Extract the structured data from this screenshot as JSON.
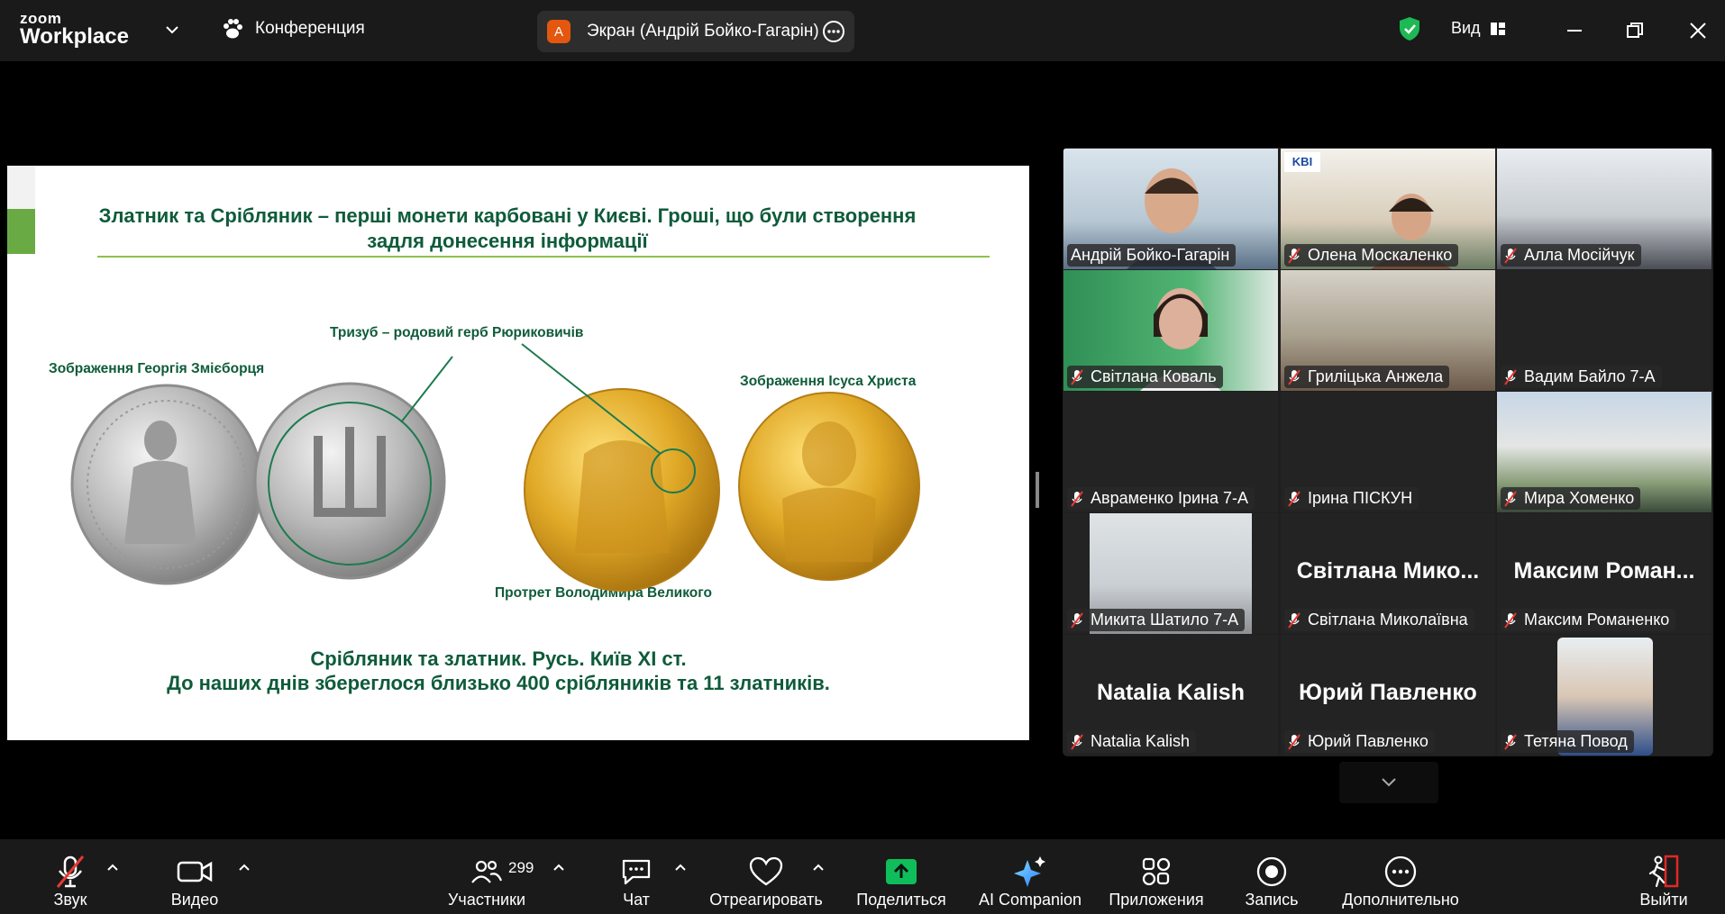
{
  "app": {
    "logo_line1": "zoom",
    "logo_line2": "Workplace",
    "meeting_label": "Конференция"
  },
  "share": {
    "avatar_letter": "A",
    "label": "Экран (Андрій Бойко-Гагарін)"
  },
  "header": {
    "view_label": "Вид"
  },
  "slide": {
    "title": "Златник та Срібляник – перші монети карбовані у Києві. Гроші, що були створення задля донесення інформації",
    "cap_george": "Зображення Георгія Змієборця",
    "cap_trident": "Тризуб – родовий герб Рюриковичів",
    "cap_jesus": "Зображення Ісуса Христа",
    "cap_volodymyr": "Протрет Володимира Великого",
    "footer1": "Срібляник та златник. Русь. Київ ХІ ст.",
    "footer2": "До наших днів збереглося близько 400 срібляників та 11 златників."
  },
  "participants": [
    {
      "name": "Андрій Бойко-Гагарін",
      "muted": false,
      "big": ""
    },
    {
      "name": "Олена Москаленко",
      "muted": true,
      "big": ""
    },
    {
      "name": "Алла Мосійчук",
      "muted": true,
      "big": ""
    },
    {
      "name": "Світлана Коваль",
      "muted": true,
      "big": ""
    },
    {
      "name": "Гриліцька Анжела",
      "muted": true,
      "big": ""
    },
    {
      "name": "Вадим Байло 7-А",
      "muted": true,
      "big": ""
    },
    {
      "name": "Авраменко Ірина 7-А",
      "muted": true,
      "big": ""
    },
    {
      "name": "Ірина ПІСКУН",
      "muted": true,
      "big": ""
    },
    {
      "name": "Мира Хоменко",
      "muted": true,
      "big": ""
    },
    {
      "name": "Микита Шатило 7-А",
      "muted": true,
      "big": ""
    },
    {
      "name": "Світлана Миколаївна",
      "muted": true,
      "big": "Світлана  Мико..."
    },
    {
      "name": "Максим Романенко",
      "muted": true,
      "big": "Максим  Роман..."
    },
    {
      "name": "Natalia Kalish",
      "muted": true,
      "big": "Natalia Kalish"
    },
    {
      "name": "Юрий Павленко",
      "muted": true,
      "big": "Юрий Павленко"
    },
    {
      "name": "Тетяна Повод",
      "muted": true,
      "big": ""
    }
  ],
  "toolbar": {
    "audio": "Звук",
    "video": "Видео",
    "participants": "Участники",
    "participants_count": "299",
    "chat": "Чат",
    "react": "Отреагировать",
    "share": "Поделиться",
    "ai": "AI Companion",
    "apps": "Приложения",
    "record": "Запись",
    "more": "Дополнительно",
    "leave": "Выйти"
  },
  "colors": {
    "accent_green": "#2dd47a",
    "share_green": "#0fbe5a",
    "leave_red": "#e02828",
    "slide_text": "#0e5b3a"
  },
  "icons": [
    "chevron-down-icon",
    "paw-icon",
    "more-icon",
    "shield-check-icon",
    "grid-view-icon",
    "minimize-icon",
    "restore-icon",
    "close-icon",
    "mic-off-icon",
    "video-camera-icon",
    "people-icon",
    "chat-icon",
    "heart-icon",
    "share-arrow-icon",
    "sparkle-icon",
    "apps-icon",
    "record-icon",
    "more-dots-icon",
    "leave-icon"
  ]
}
